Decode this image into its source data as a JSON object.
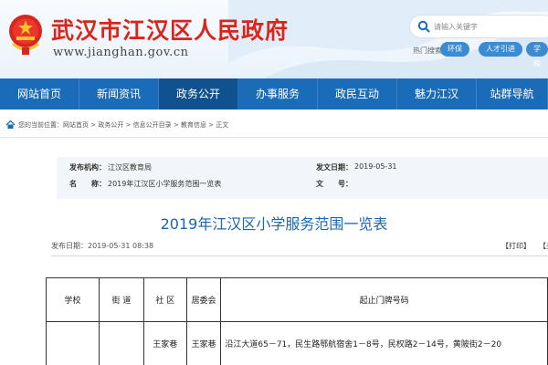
{
  "header": {
    "title": "武汉市江汉区人民政府",
    "url": "www.jianghan.gov.cn",
    "search_placeholder": "请输入关键字",
    "hot_label": "热门搜索：",
    "hot_tags": [
      "环保",
      "人才引进",
      "学校"
    ]
  },
  "nav": {
    "items": [
      "网站首页",
      "新闻资讯",
      "政务公开",
      "办事服务",
      "政民互动",
      "魅力江汉",
      "站群导航"
    ],
    "active": "政务公开"
  },
  "breadcrumb": {
    "text": "您的当前位置：网站首页 > 政务公开 > 信息公开目录 > 教育信息 > 正文"
  },
  "meta": {
    "publisher_label": "发布机构：",
    "publisher": "江汉区教育局",
    "date_label": "发文日期：",
    "date": "2019-05-31",
    "name_label": "名　　称：",
    "name": "2019年江汉区小学服务范围一览表",
    "docno_label": "文　　号：",
    "docno": ""
  },
  "article": {
    "title": "2019年江汉区小学服务范围一览表",
    "pub_time": "发布日期：2019-05-31 08:38",
    "print": "【打印】",
    "close": "【关"
  },
  "table": {
    "headers": [
      "学校",
      "街 道",
      "社 区",
      "居委会",
      "起止门牌号码"
    ],
    "rows": [
      [
        "",
        "",
        "王家巷",
        "王家巷",
        "沿江大道65－71，民生路鄂航宿舍1－8号，民权路2－14号，黄陂街2－20"
      ]
    ]
  },
  "colors": {
    "nav_bg": "#1a6cb8",
    "nav_active": "#10518f",
    "title_red": "#d9261c",
    "article_title_blue": "#1a66b2"
  }
}
